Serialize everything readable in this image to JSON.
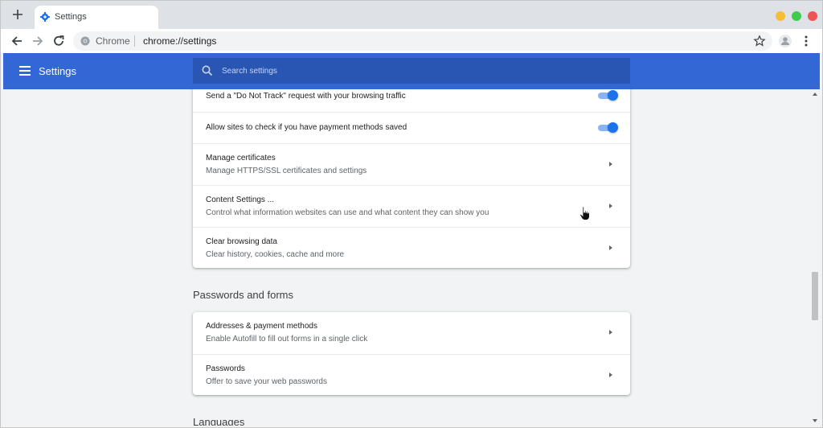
{
  "window": {
    "tab_title": "Settings",
    "new_tab_icon": "plus-icon",
    "controls": [
      "minimize",
      "maximize",
      "close"
    ],
    "colors": {
      "minimize": "#f6be37",
      "maximize": "#3dcc4b",
      "close": "#ee5454"
    }
  },
  "toolbar": {
    "site_chip": "Chrome",
    "url": "chrome://settings",
    "icons": [
      "back-icon",
      "forward-icon",
      "reload-icon",
      "star-icon",
      "profile-icon",
      "menu-icon"
    ]
  },
  "header": {
    "title": "Settings",
    "search_placeholder": "Search settings",
    "accent": "#3367d6"
  },
  "privacy_card": {
    "rows": [
      {
        "label": "Send a \"Do Not Track\" request with your browsing traffic",
        "toggle": true
      },
      {
        "label": "Allow sites to check if you have payment methods saved",
        "toggle": true
      },
      {
        "label": "Manage certificates",
        "sub": "Manage HTTPS/SSL certificates and settings"
      },
      {
        "label": "Content Settings ...",
        "sub": "Control what information websites can use and what content they can show you"
      },
      {
        "label": "Clear browsing data",
        "sub": "Clear history, cookies, cache and more"
      }
    ]
  },
  "passwords_section": {
    "title": "Passwords and forms",
    "rows": [
      {
        "label": "Addresses & payment methods",
        "sub": "Enable Autofill to fill out forms in a single click"
      },
      {
        "label": "Passwords",
        "sub": "Offer to save your web passwords"
      }
    ]
  },
  "languages_section": {
    "title": "Languages"
  }
}
